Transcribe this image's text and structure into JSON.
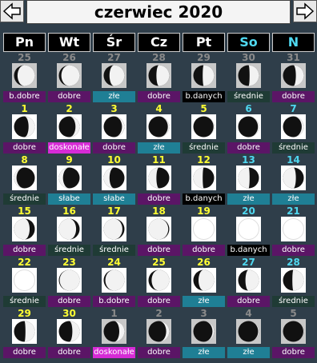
{
  "header": {
    "title": "czerwiec 2020",
    "prev_icon": "prev-arrow-icon",
    "next_icon": "next-arrow-icon"
  },
  "weekdays": [
    "Pn",
    "Wt",
    "Śr",
    "Cz",
    "Pt",
    "So",
    "N"
  ],
  "colors": {
    "good": "#5b1566",
    "excellent": "#d62bd6",
    "bad": "#1f7f95",
    "nodata": "#000000",
    "medium": "#1f3b35",
    "weak": "#1f7f95"
  },
  "weeks": [
    [
      {
        "day": "25",
        "other": true,
        "phase": 0.83,
        "label": "b.dobre",
        "cat": "good"
      },
      {
        "day": "26",
        "other": true,
        "phase": 0.88,
        "label": "dobre",
        "cat": "good"
      },
      {
        "day": "27",
        "other": true,
        "phase": 0.72,
        "label": "złe",
        "cat": "bad"
      },
      {
        "day": "28",
        "other": true,
        "phase": 0.62,
        "label": "dobre",
        "cat": "good"
      },
      {
        "day": "29",
        "other": true,
        "phase": 0.55,
        "label": "b.danych",
        "cat": "nodata"
      },
      {
        "day": "30",
        "other": true,
        "phase": 0.45,
        "label": "średnie",
        "cat": "medium"
      },
      {
        "day": "31",
        "other": true,
        "phase": 0.38,
        "label": "dobre",
        "cat": "good"
      }
    ],
    [
      {
        "day": "1",
        "phase": 0.3,
        "label": "dobre",
        "cat": "good"
      },
      {
        "day": "2",
        "phase": 0.2,
        "label": "doskonałe",
        "cat": "excellent"
      },
      {
        "day": "3",
        "phase": 0.12,
        "label": "dobre",
        "cat": "good"
      },
      {
        "day": "4",
        "phase": 0.07,
        "label": "złe",
        "cat": "bad"
      },
      {
        "day": "5",
        "phase": 0.03,
        "label": "średnie",
        "cat": "medium"
      },
      {
        "day": "6",
        "weekend": true,
        "phase": 0.05,
        "label": "dobre",
        "cat": "good"
      },
      {
        "day": "7",
        "weekend": true,
        "phase": 0.1,
        "label": "średnie",
        "cat": "medium"
      }
    ],
    [
      {
        "day": "8",
        "phase": -0.12,
        "label": "średnie",
        "cat": "medium"
      },
      {
        "day": "9",
        "phase": -0.2,
        "label": "słabe",
        "cat": "weak"
      },
      {
        "day": "10",
        "phase": -0.28,
        "label": "słabe",
        "cat": "weak"
      },
      {
        "day": "11",
        "phase": -0.38,
        "label": "dobre",
        "cat": "good"
      },
      {
        "day": "12",
        "phase": -0.45,
        "label": "b.danych",
        "cat": "nodata"
      },
      {
        "day": "13",
        "weekend": true,
        "phase": -0.55,
        "label": "złe",
        "cat": "bad"
      },
      {
        "day": "14",
        "weekend": true,
        "phase": -0.62,
        "label": "złe",
        "cat": "bad"
      }
    ],
    [
      {
        "day": "15",
        "phase": -0.75,
        "label": "dobre",
        "cat": "good"
      },
      {
        "day": "16",
        "phase": -0.83,
        "label": "średnie",
        "cat": "medium"
      },
      {
        "day": "17",
        "phase": -0.9,
        "label": "średnie",
        "cat": "medium"
      },
      {
        "day": "18",
        "phase": -0.95,
        "label": "dobre",
        "cat": "good"
      },
      {
        "day": "19",
        "phase": 1,
        "label": "dobre",
        "cat": "good"
      },
      {
        "day": "20",
        "weekend": true,
        "phase": 1,
        "label": "b.danych",
        "cat": "nodata"
      },
      {
        "day": "21",
        "weekend": true,
        "phase": 1,
        "label": "dobre",
        "cat": "good"
      }
    ],
    [
      {
        "day": "22",
        "phase": 1,
        "label": "średnie",
        "cat": "medium"
      },
      {
        "day": "23",
        "phase": 0.96,
        "label": "dobre",
        "cat": "good"
      },
      {
        "day": "24",
        "phase": 0.92,
        "label": "b.dobre",
        "cat": "good"
      },
      {
        "day": "25",
        "phase": 0.85,
        "label": "dobre",
        "cat": "good"
      },
      {
        "day": "26",
        "phase": 0.75,
        "label": "złe",
        "cat": "bad"
      },
      {
        "day": "27",
        "weekend": true,
        "phase": 0.65,
        "label": "dobre",
        "cat": "good"
      },
      {
        "day": "28",
        "weekend": true,
        "phase": 0.55,
        "label": "średnie",
        "cat": "medium"
      }
    ],
    [
      {
        "day": "29",
        "phase": 0.45,
        "label": "dobre",
        "cat": "good"
      },
      {
        "day": "30",
        "phase": 0.35,
        "label": "dobre",
        "cat": "good"
      },
      {
        "day": "1",
        "other": true,
        "phase": 0.25,
        "label": "doskonałe",
        "cat": "excellent"
      },
      {
        "day": "2",
        "other": true,
        "phase": 0.15,
        "label": "dobre",
        "cat": "good"
      },
      {
        "day": "3",
        "other": true,
        "phase": 0.08,
        "label": "złe",
        "cat": "bad"
      },
      {
        "day": "4",
        "other": true,
        "phase": 0.04,
        "label": "złe",
        "cat": "bad"
      },
      {
        "day": "5",
        "other": true,
        "phase": 0.02,
        "label": "dobre",
        "cat": "good"
      }
    ]
  ]
}
